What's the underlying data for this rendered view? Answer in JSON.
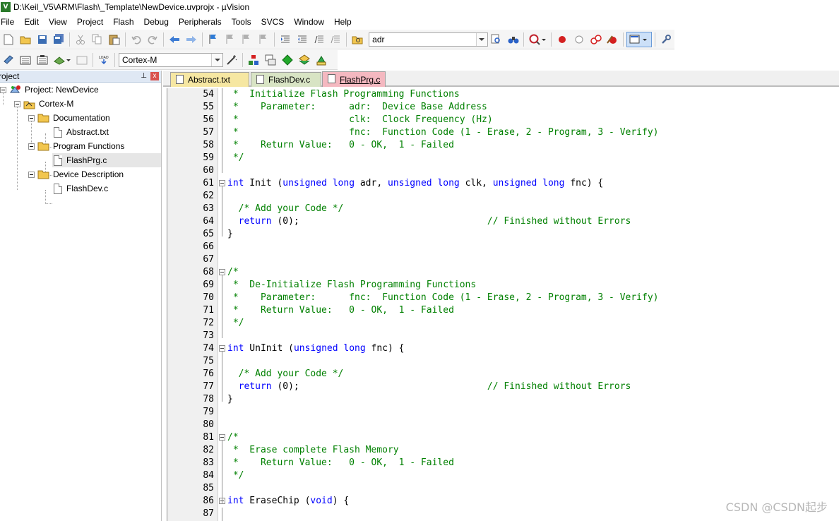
{
  "window": {
    "title": "D:\\Keil_V5\\ARM\\Flash\\_Template\\NewDevice.uvprojx - µVision",
    "app_icon_text": "V"
  },
  "menu": [
    "File",
    "Edit",
    "View",
    "Project",
    "Flash",
    "Debug",
    "Peripherals",
    "Tools",
    "SVCS",
    "Window",
    "Help"
  ],
  "toolbar": {
    "find_combo_value": "adr",
    "target_combo_value": "Cortex-M"
  },
  "project_panel": {
    "title": "roject",
    "pin": "⊥",
    "close": "x",
    "tree": [
      {
        "label": "Project: NewDevice",
        "level": 0,
        "kind": "project"
      },
      {
        "label": "Cortex-M",
        "level": 1,
        "kind": "target"
      },
      {
        "label": "Documentation",
        "level": 2,
        "kind": "folder"
      },
      {
        "label": "Abstract.txt",
        "level": 3,
        "kind": "file"
      },
      {
        "label": "Program Functions",
        "level": 2,
        "kind": "folder"
      },
      {
        "label": "FlashPrg.c",
        "level": 3,
        "kind": "file",
        "selected": true
      },
      {
        "label": "Device Description",
        "level": 2,
        "kind": "folder"
      },
      {
        "label": "FlashDev.c",
        "level": 3,
        "kind": "file"
      }
    ]
  },
  "tabs": [
    {
      "label": "Abstract.txt"
    },
    {
      "label": "FlashDev.c"
    },
    {
      "label": "FlashPrg.c",
      "active": true
    }
  ],
  "code": {
    "lines": [
      {
        "n": "54",
        "parts": [
          [
            "cmt",
            " *  Initialize Flash Programming Functions"
          ]
        ]
      },
      {
        "n": "55",
        "parts": [
          [
            "cmt",
            " *    Parameter:      adr:  Device Base Address"
          ]
        ]
      },
      {
        "n": "56",
        "parts": [
          [
            "cmt",
            " *                    clk:  Clock Frequency (Hz)"
          ]
        ]
      },
      {
        "n": "57",
        "parts": [
          [
            "cmt",
            " *                    fnc:  Function Code (1 - Erase, 2 - Program, 3 - Verify)"
          ]
        ]
      },
      {
        "n": "58",
        "parts": [
          [
            "cmt",
            " *    Return Value:   0 - OK,  1 - Failed"
          ]
        ]
      },
      {
        "n": "59",
        "parts": [
          [
            "cmt",
            " */"
          ]
        ]
      },
      {
        "n": "60",
        "parts": []
      },
      {
        "n": "61",
        "fold": true,
        "parts": [
          [
            "kw",
            "int"
          ],
          [
            "",
            " Init ("
          ],
          [
            "kw",
            "unsigned long"
          ],
          [
            "",
            " adr, "
          ],
          [
            "kw",
            "unsigned long"
          ],
          [
            "",
            " clk, "
          ],
          [
            "kw",
            "unsigned long"
          ],
          [
            "",
            " fnc) {"
          ]
        ]
      },
      {
        "n": "62",
        "parts": []
      },
      {
        "n": "63",
        "parts": [
          [
            "cmt",
            "  /* Add your Code */"
          ]
        ]
      },
      {
        "n": "64",
        "parts": [
          [
            "kw",
            "  return"
          ],
          [
            "",
            " (0);                                  "
          ],
          [
            "cmt",
            "// Finished without Errors"
          ]
        ]
      },
      {
        "n": "65",
        "parts": [
          [
            "",
            "}"
          ]
        ]
      },
      {
        "n": "66",
        "parts": []
      },
      {
        "n": "67",
        "parts": []
      },
      {
        "n": "68",
        "fold": true,
        "parts": [
          [
            "cmt",
            "/*"
          ]
        ]
      },
      {
        "n": "69",
        "parts": [
          [
            "cmt",
            " *  De-Initialize Flash Programming Functions"
          ]
        ]
      },
      {
        "n": "70",
        "parts": [
          [
            "cmt",
            " *    Parameter:      fnc:  Function Code (1 - Erase, 2 - Program, 3 - Verify)"
          ]
        ]
      },
      {
        "n": "71",
        "parts": [
          [
            "cmt",
            " *    Return Value:   0 - OK,  1 - Failed"
          ]
        ]
      },
      {
        "n": "72",
        "parts": [
          [
            "cmt",
            " */"
          ]
        ]
      },
      {
        "n": "73",
        "parts": []
      },
      {
        "n": "74",
        "fold": true,
        "parts": [
          [
            "kw",
            "int"
          ],
          [
            "",
            " UnInit ("
          ],
          [
            "kw",
            "unsigned long"
          ],
          [
            "",
            " fnc) {"
          ]
        ]
      },
      {
        "n": "75",
        "parts": []
      },
      {
        "n": "76",
        "parts": [
          [
            "cmt",
            "  /* Add your Code */"
          ]
        ]
      },
      {
        "n": "77",
        "parts": [
          [
            "kw",
            "  return"
          ],
          [
            "",
            " (0);                                  "
          ],
          [
            "cmt",
            "// Finished without Errors"
          ]
        ]
      },
      {
        "n": "78",
        "parts": [
          [
            "",
            "}"
          ]
        ]
      },
      {
        "n": "79",
        "parts": []
      },
      {
        "n": "80",
        "parts": []
      },
      {
        "n": "81",
        "fold": true,
        "parts": [
          [
            "cmt",
            "/*"
          ]
        ]
      },
      {
        "n": "82",
        "parts": [
          [
            "cmt",
            " *  Erase complete Flash Memory"
          ]
        ]
      },
      {
        "n": "83",
        "parts": [
          [
            "cmt",
            " *    Return Value:   0 - OK,  1 - Failed"
          ]
        ]
      },
      {
        "n": "84",
        "parts": [
          [
            "cmt",
            " */"
          ]
        ]
      },
      {
        "n": "85",
        "parts": []
      },
      {
        "n": "86",
        "fold": true,
        "parts": [
          [
            "kw",
            "int"
          ],
          [
            "",
            " EraseChip ("
          ],
          [
            "kw",
            "void"
          ],
          [
            "",
            ") {"
          ]
        ]
      },
      {
        "n": "87",
        "parts": []
      }
    ]
  },
  "watermark": "CSDN @CSDN起步",
  "colors": {
    "comment": "#008000",
    "keyword": "#0000ff",
    "panel_header": "#dfe8f4",
    "tab_abstract": "#f6e7a2",
    "tab_flashdev": "#d8e4c4",
    "tab_flashprg": "#f4b8c0"
  }
}
